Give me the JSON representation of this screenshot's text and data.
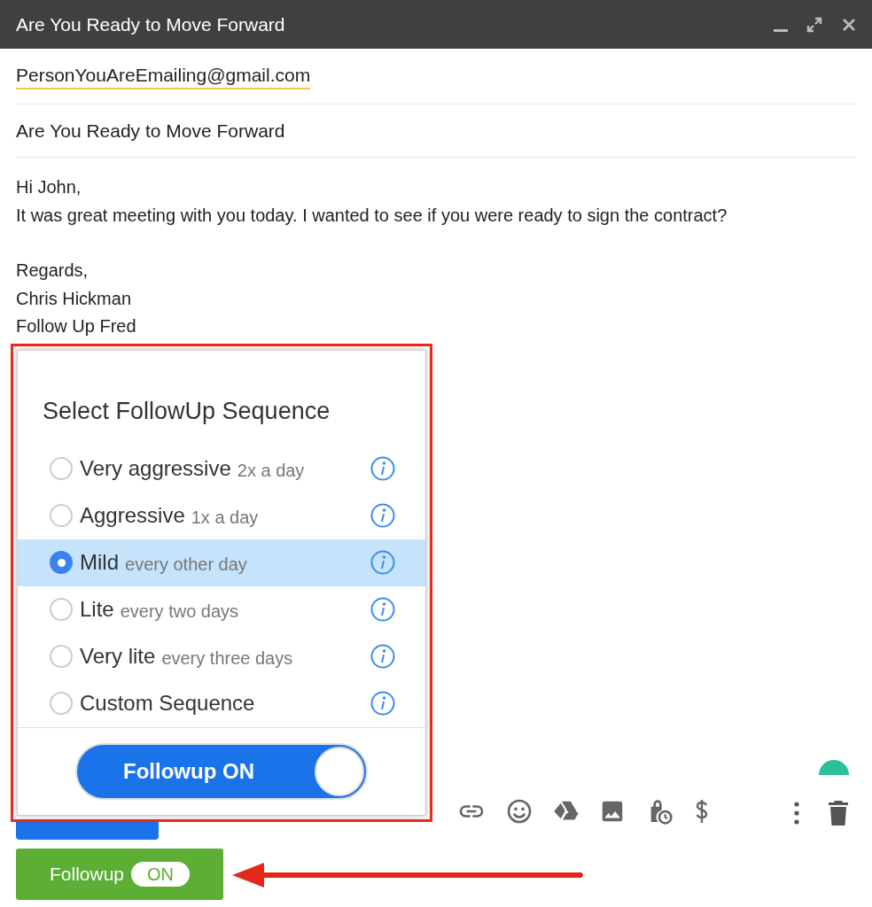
{
  "window": {
    "title": "Are You Ready to Move Forward"
  },
  "to": "PersonYouAreEmailing@gmail.com",
  "subject": "Are You Ready to Move Forward",
  "body": [
    {
      "lines": [
        "Hi John,",
        "It was great meeting with you today. I wanted to see if you were ready to sign the contract?"
      ]
    },
    {
      "lines": [
        "Regards,",
        "Chris Hickman",
        "Follow Up Fred"
      ]
    }
  ],
  "popup": {
    "title": "Select FollowUp Sequence",
    "options": [
      {
        "label": "Very aggressive",
        "frequency": "2x a day",
        "selected": false
      },
      {
        "label": "Aggressive",
        "frequency": "1x a day",
        "selected": false
      },
      {
        "label": "Mild",
        "frequency": "every other day",
        "selected": true
      },
      {
        "label": "Lite",
        "frequency": "every two days",
        "selected": false
      },
      {
        "label": "Very lite",
        "frequency": "every three days",
        "selected": false
      },
      {
        "label": "Custom Sequence",
        "selected": false
      }
    ],
    "toggle": {
      "label": "Followup ON",
      "on": true
    }
  },
  "followup_button": {
    "label": "Followup",
    "badge": "ON",
    "on": true
  }
}
